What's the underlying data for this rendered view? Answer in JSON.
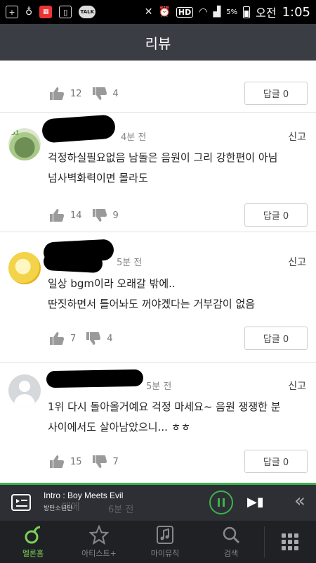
{
  "status_bar": {
    "time": "1:05",
    "ampm": "오전",
    "battery": "5%",
    "hd": "HD",
    "talk": "TALK"
  },
  "header": {
    "title": "리뷰"
  },
  "reviews": [
    {
      "author": "",
      "time": "",
      "content": [
        "",
        ""
      ],
      "likes": "12",
      "dislikes": "4",
      "reply_label": "답글 0",
      "report": ""
    },
    {
      "author": "",
      "time": "4분 전",
      "content": [
        "걱정하실필요없음 남돌은 음원이 그리 강한편이 아님",
        "넘사벽화력이면 몰라도"
      ],
      "likes": "14",
      "dislikes": "9",
      "reply_label": "답글 0",
      "report": "신고"
    },
    {
      "author": "",
      "time": "5분 전",
      "content": [
        "일상 bgm이라 오래갈 밖에..",
        "딴짓하면서 틀어놔도 꺼야겠다는 거부감이 없음"
      ],
      "likes": "7",
      "dislikes": "4",
      "reply_label": "답글 0",
      "report": "신고"
    },
    {
      "author": "",
      "time": "5분 전",
      "content": [
        "1위 다시 돌아올거예요 걱정 마세요~ 음원 쟁쟁한 분",
        "사이에서도 살아남았으니... ㅎㅎ"
      ],
      "likes": "15",
      "dislikes": "7",
      "reply_label": "답글 0",
      "report": "신고"
    }
  ],
  "player": {
    "track": "Intro : Boy Meets Evil",
    "artist": "방탄소년단",
    "ghost_text": "대에",
    "ghost_time": "6분 전"
  },
  "bottom_nav": [
    {
      "label": "멜론홈",
      "icon": "melon-home-icon",
      "active": true
    },
    {
      "label": "아티스트+",
      "icon": "star-icon",
      "active": false
    },
    {
      "label": "마이뮤직",
      "icon": "music-note-icon",
      "active": false
    },
    {
      "label": "검색",
      "icon": "search-icon",
      "active": false
    }
  ],
  "colors": {
    "accent": "#3cb44b",
    "header_bg": "#3a3d44",
    "nav_bg": "#1f2125"
  }
}
